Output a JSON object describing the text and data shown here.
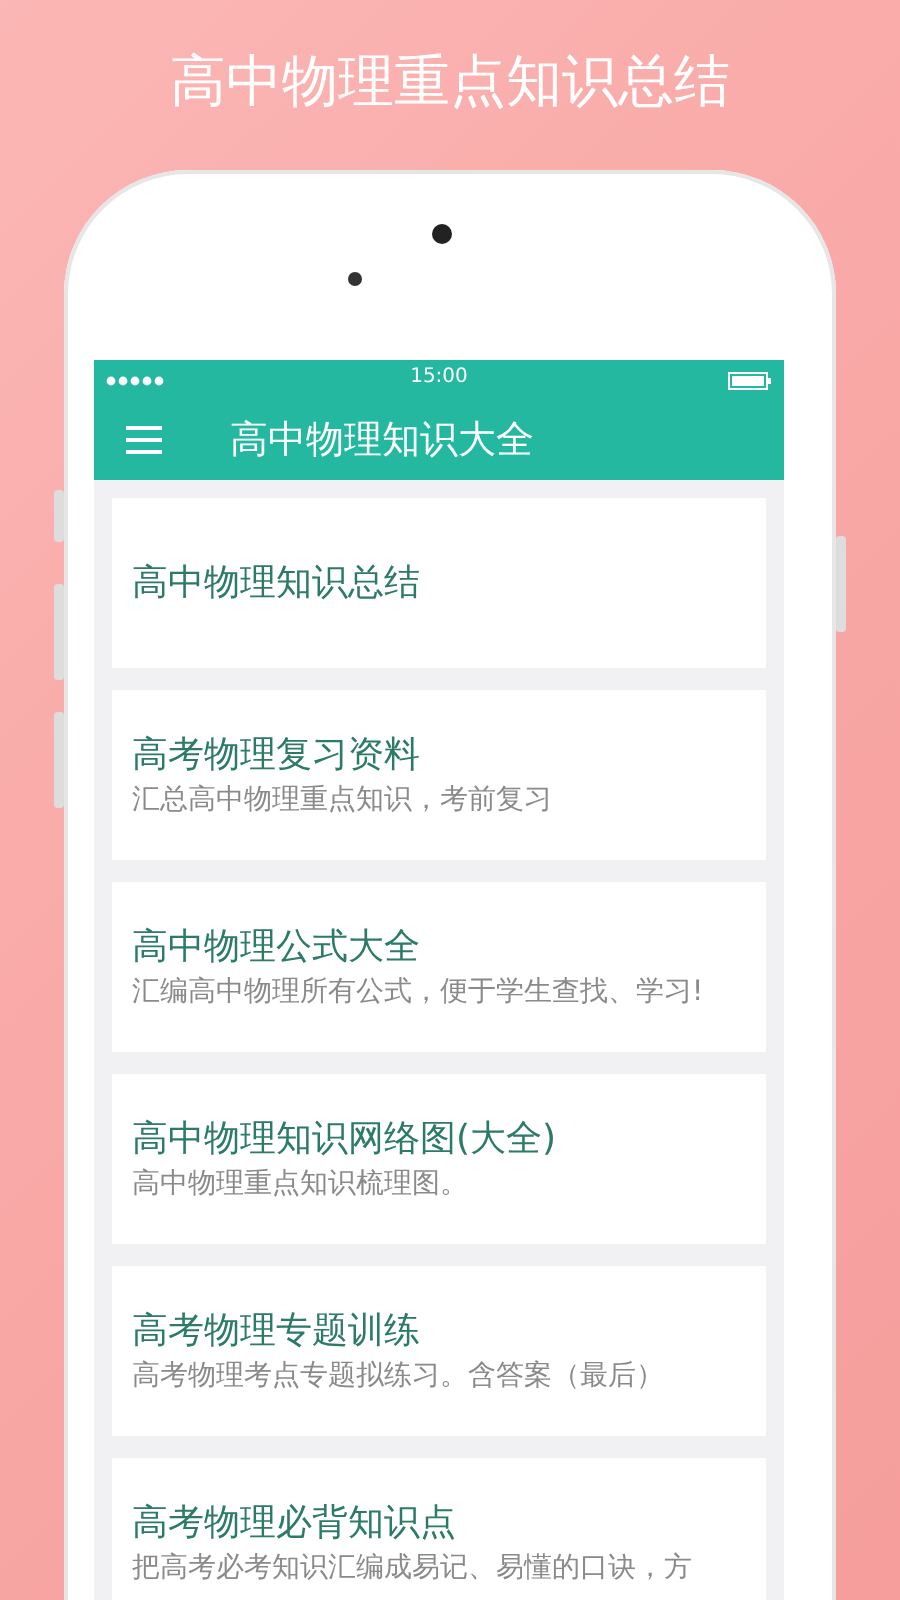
{
  "headline": "高中物理重点知识总结",
  "status_bar": {
    "time": "15:00"
  },
  "app_bar": {
    "title": "高中物理知识大全"
  },
  "topics": [
    {
      "title": "高中物理知识总结"
    },
    {
      "title": "高考物理复习资料",
      "description": "汇总高中物理重点知识，考前复习"
    },
    {
      "title": "高中物理公式大全",
      "description": "汇编高中物理所有公式，便于学生查找、学习!"
    },
    {
      "title": "高中物理知识网络图(大全)",
      "description": "高中物理重点知识梳理图。"
    },
    {
      "title": "高考物理专题训练",
      "description": "高考物理考点专题拟练习。含答案（最后）"
    },
    {
      "title": "高考物理必背知识点",
      "description": "把高考必考知识汇编成易记、易懂的口诀，方"
    }
  ]
}
